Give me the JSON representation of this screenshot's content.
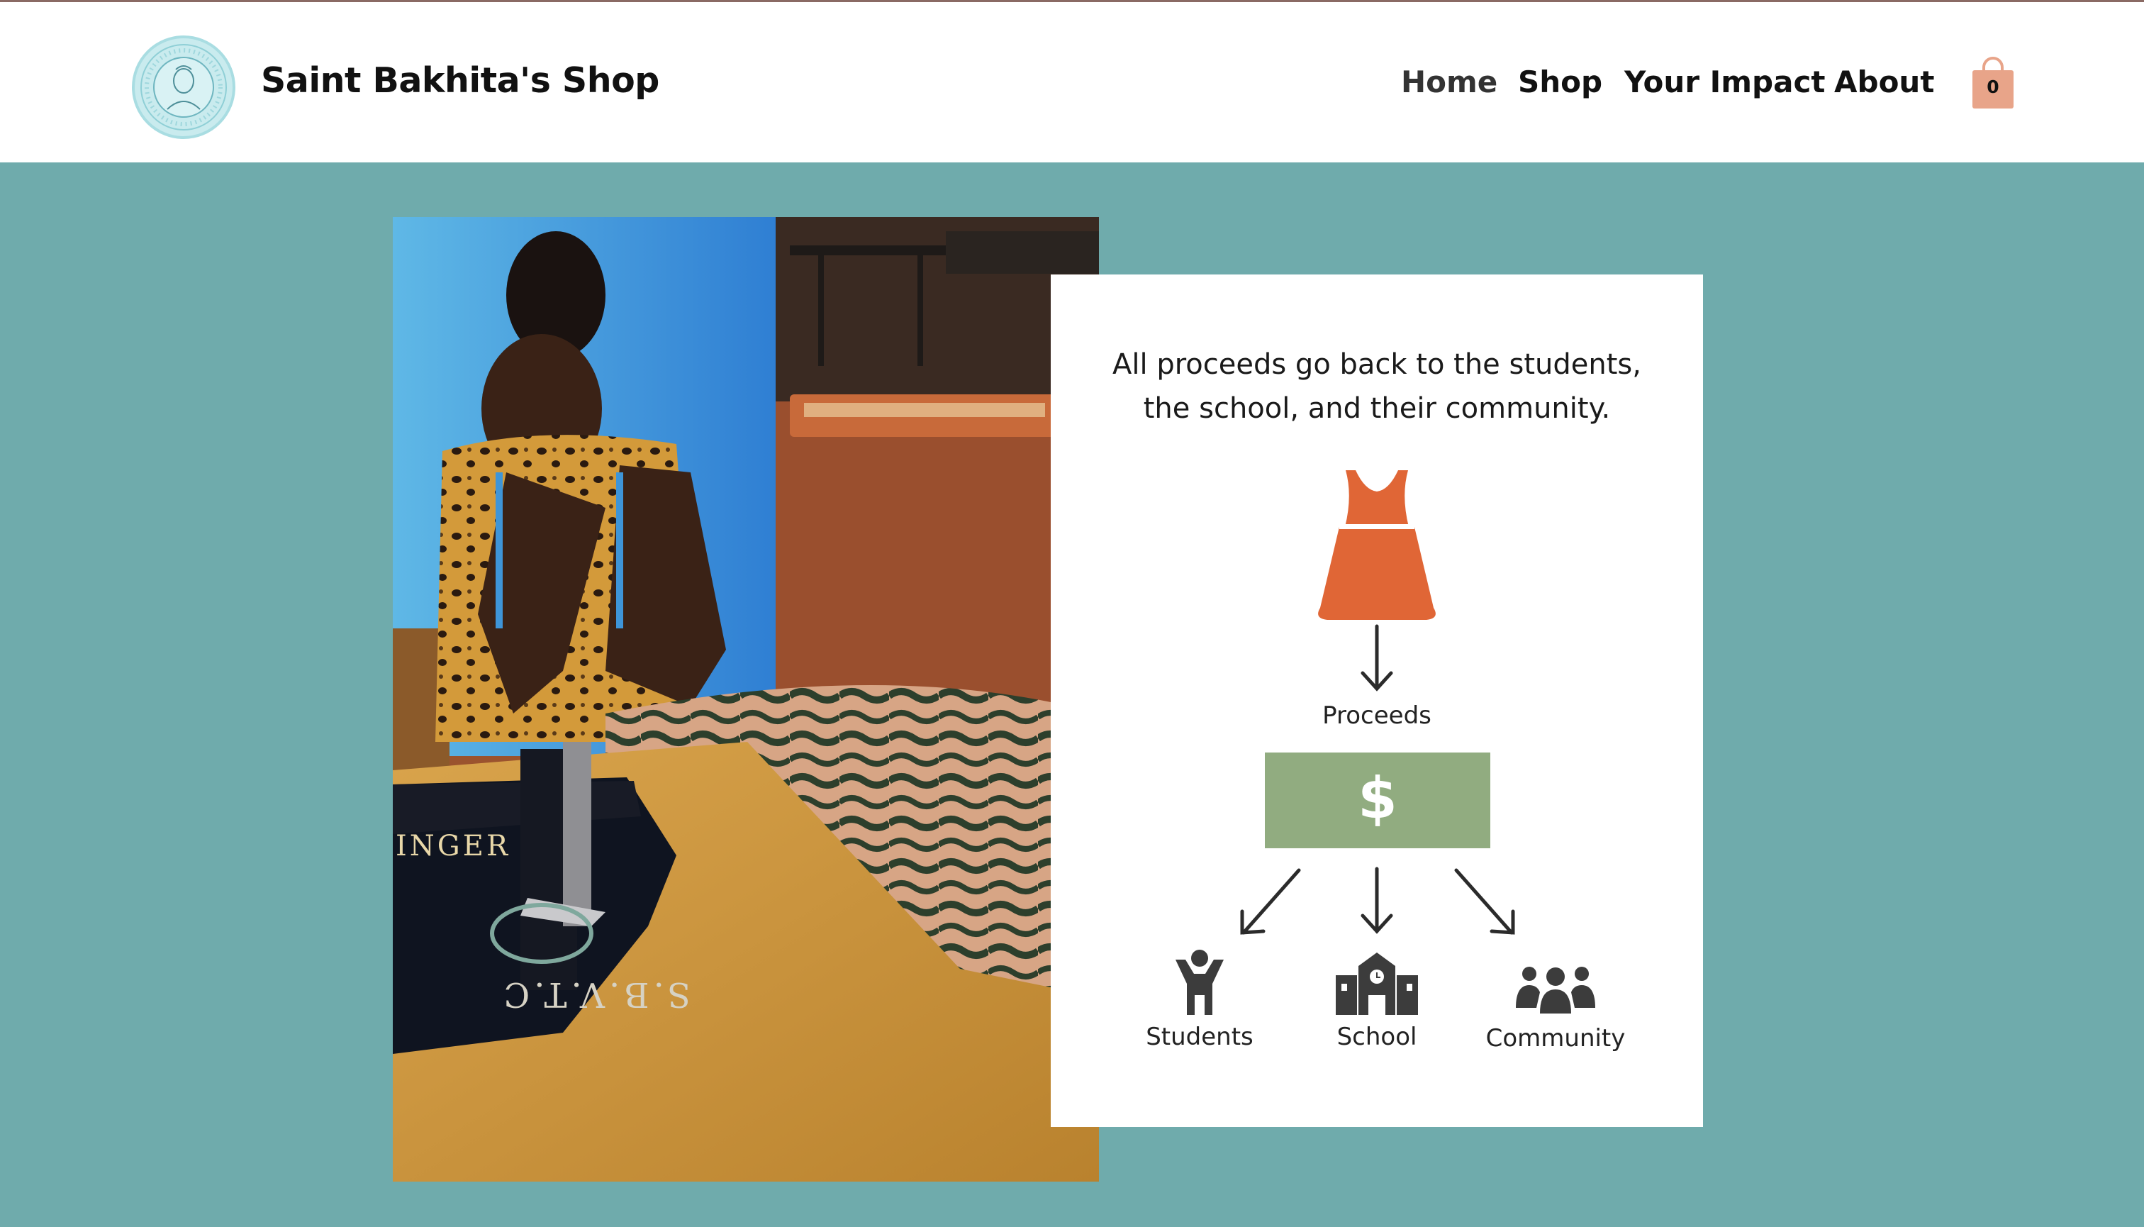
{
  "header": {
    "site_title": "Saint Bakhita's Shop",
    "logo_icon": "school-seal-logo",
    "nav": [
      {
        "label": "Home",
        "active": true
      },
      {
        "label": "Shop",
        "active": false
      },
      {
        "label": "Your Impact",
        "active": false
      },
      {
        "label": "About",
        "active": false
      }
    ],
    "cart": {
      "icon": "shopping-bag-icon",
      "count": "0"
    }
  },
  "colors": {
    "page_background": "#6fabac",
    "header_background": "#ffffff",
    "dress_accent": "#e06636",
    "money_box": "#91ac80",
    "cart_icon": "#e8a489"
  },
  "hero": {
    "photo": "student-sewing-at-singer-machine-photo",
    "machine_lettering": [
      "INGER",
      "S.B.V.T.C"
    ]
  },
  "impact_card": {
    "heading_line_1": "All proceeds go back to the students,",
    "heading_line_2": "the school, and their community.",
    "dress_icon": "dress-icon",
    "proceeds_label": "Proceeds",
    "money_symbol": "$",
    "beneficiaries": [
      {
        "label": "Students",
        "icon": "student-icon"
      },
      {
        "label": "School",
        "icon": "school-building-icon"
      },
      {
        "label": "Community",
        "icon": "community-group-icon"
      }
    ]
  }
}
